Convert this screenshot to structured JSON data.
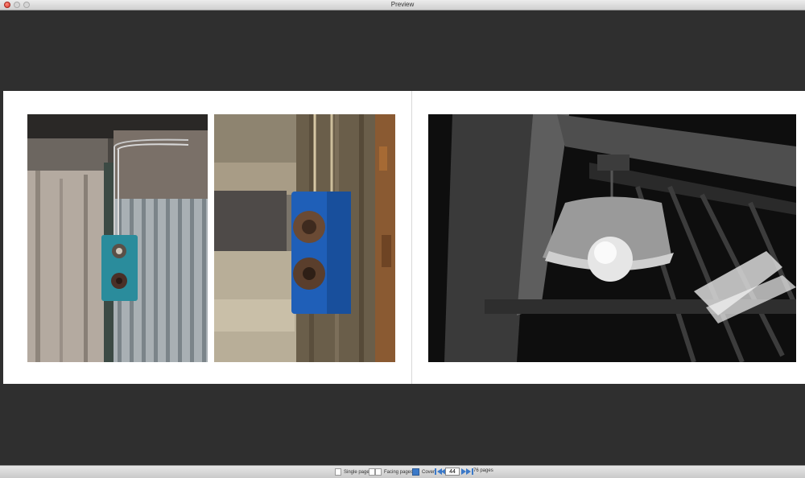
{
  "window": {
    "title": "Preview"
  },
  "toolbar": {
    "single_page_label": "Single page",
    "facing_pages_label": "Facing pages",
    "cover_label": "Cover",
    "page_number": "44",
    "page_count_label": "76 pages"
  },
  "colors": {
    "canvas": "#2f2f2f",
    "spread": "#ffffff",
    "accent": "#3b79c8"
  }
}
